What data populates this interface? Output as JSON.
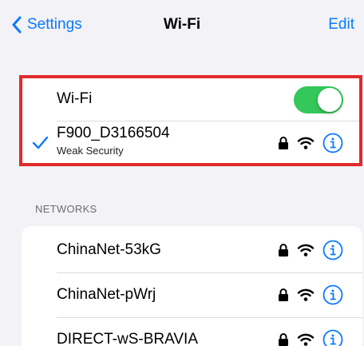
{
  "nav": {
    "back_label": "Settings",
    "title": "Wi-Fi",
    "edit_label": "Edit"
  },
  "wifi_toggle": {
    "label": "Wi-Fi",
    "on": true
  },
  "connected": {
    "name": "F900_D3166504",
    "subtitle": "Weak Security"
  },
  "networks": {
    "header": "NETWORKS",
    "items": [
      {
        "name": "ChinaNet-53kG"
      },
      {
        "name": "ChinaNet-pWrj"
      },
      {
        "name": "DIRECT-wS-BRAVIA"
      }
    ]
  },
  "colors": {
    "accent": "#0a7aff",
    "toggle_on": "#34c759",
    "highlight": "#e12a2a",
    "background": "#f2f2f7"
  },
  "icons": {
    "back": "chevron-left-icon",
    "check": "checkmark-icon",
    "lock": "lock-icon",
    "wifi": "wifi-signal-icon",
    "info": "info-circle-icon"
  }
}
